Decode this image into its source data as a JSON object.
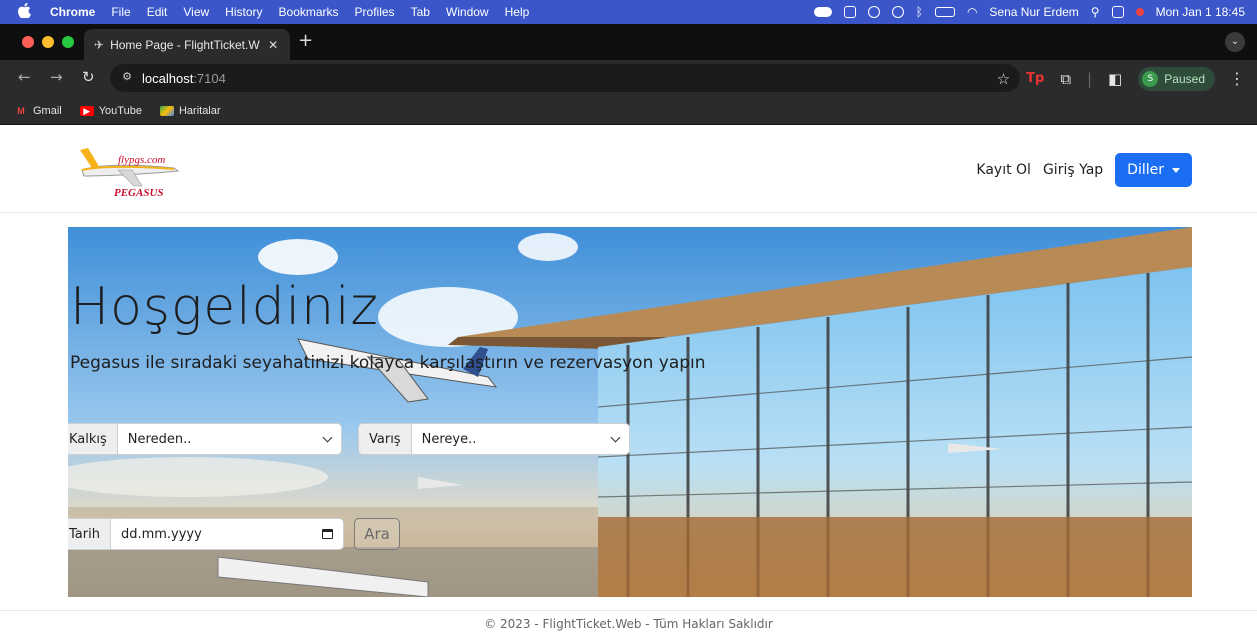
{
  "menubar": {
    "app_name": "Chrome",
    "items": [
      "File",
      "Edit",
      "View",
      "History",
      "Bookmarks",
      "Profiles",
      "Tab",
      "Window",
      "Help"
    ],
    "user": "Sena Nur Erdem",
    "datetime": "Mon Jan 1  18:45"
  },
  "browser": {
    "tab_title": "Home Page - FlightTicket.Web",
    "url_host": "localhost",
    "url_port": ":7104",
    "profile_label": "Paused",
    "profile_initial": "S",
    "bookmarks": [
      "Gmail",
      "YouTube",
      "Haritalar"
    ]
  },
  "site": {
    "logo_top": "flypgs.com",
    "logo_bottom": "PEGASUS",
    "nav": {
      "register": "Kayıt Ol",
      "login": "Giriş Yap",
      "languages": "Diller"
    },
    "hero": {
      "title": "Hoşgeldiniz",
      "subtitle": "Pegasus ile sıradaki seyahatinizi kolayca karşılaştırın ve rezervasyon yapın"
    },
    "form": {
      "from_label": "Kalkış",
      "from_value": "Nereden..",
      "to_label": "Varış",
      "to_value": "Nereye..",
      "date_label": "Tarih",
      "date_value": "dd.mm.yyyy",
      "search_label": "Ara"
    },
    "footer": "© 2023 - FlightTicket.Web - Tüm Hakları Saklıdır"
  },
  "colors": {
    "menubar": "#3a56c8",
    "primary": "#1b6ef3",
    "pegasus_yellow": "#f5b21a",
    "pegasus_red": "#c8102e"
  }
}
